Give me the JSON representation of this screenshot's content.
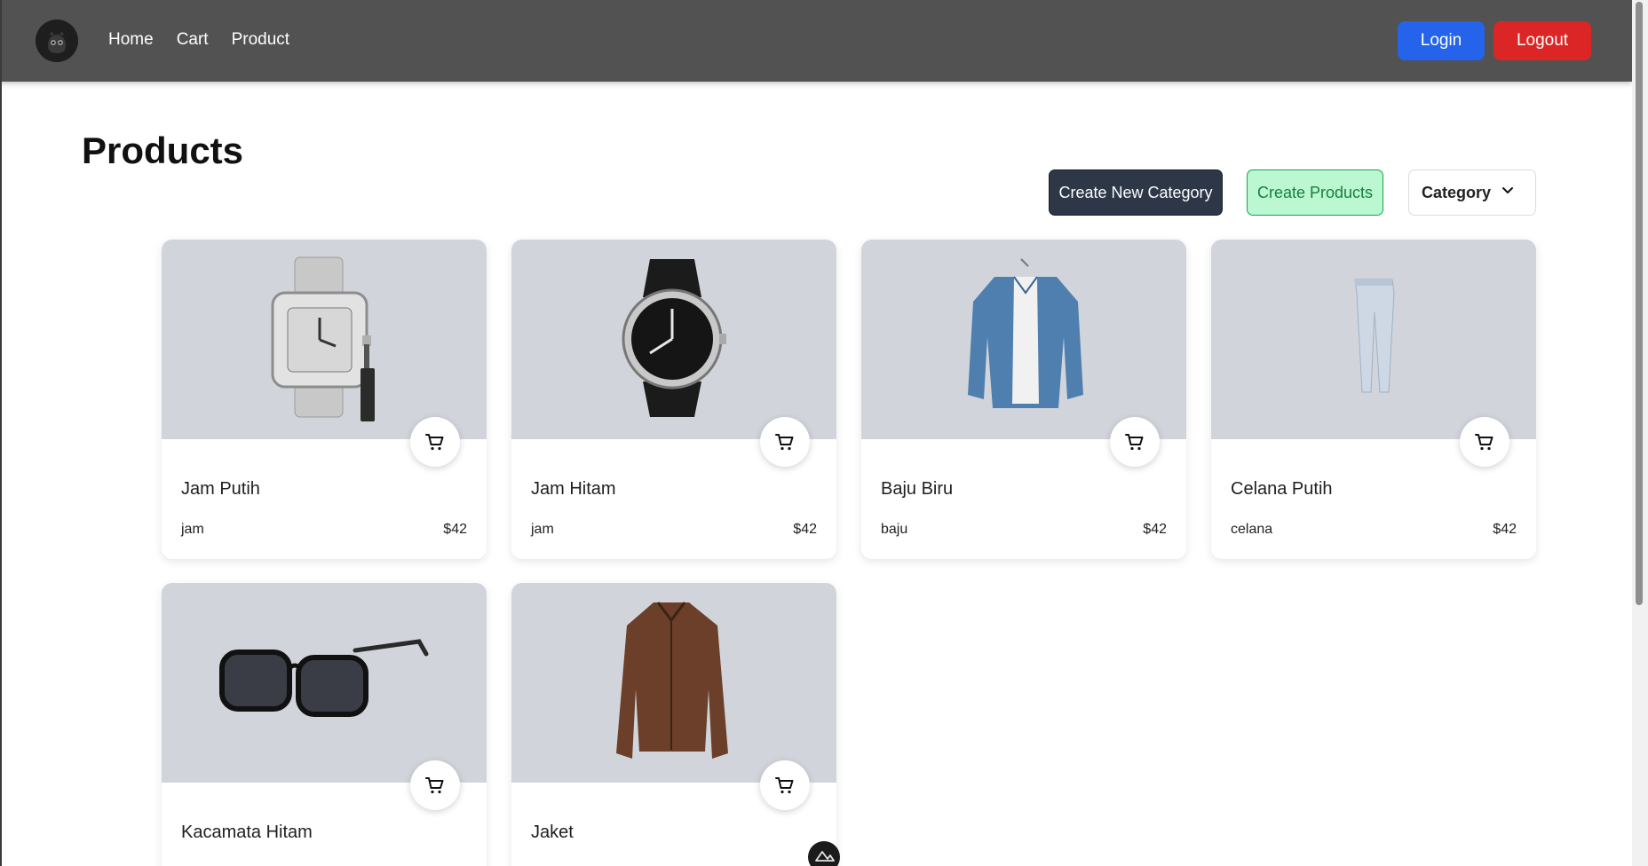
{
  "nav": {
    "links": [
      "Home",
      "Cart",
      "Product"
    ],
    "login_label": "Login",
    "logout_label": "Logout",
    "colors": {
      "bar": "#525252",
      "login": "#2563eb",
      "logout": "#dc2626"
    }
  },
  "page": {
    "title": "Products",
    "create_category_label": "Create New Category",
    "create_products_label": "Create Products",
    "category_select_value": "Category"
  },
  "products": [
    {
      "name": "Jam Putih",
      "category": "jam",
      "price": "$42",
      "image_icon": "silver-watch-image"
    },
    {
      "name": "Jam Hitam",
      "category": "jam",
      "price": "$42",
      "image_icon": "black-watch-image"
    },
    {
      "name": "Baju Biru",
      "category": "baju",
      "price": "$42",
      "image_icon": "blue-shirt-image"
    },
    {
      "name": "Celana Putih",
      "category": "celana",
      "price": "$42",
      "image_icon": "jeans-image"
    },
    {
      "name": "Kacamata Hitam",
      "category": "",
      "price": "",
      "image_icon": "sunglasses-image"
    },
    {
      "name": "Jaket",
      "category": "",
      "price": "",
      "image_icon": "jacket-image"
    }
  ]
}
